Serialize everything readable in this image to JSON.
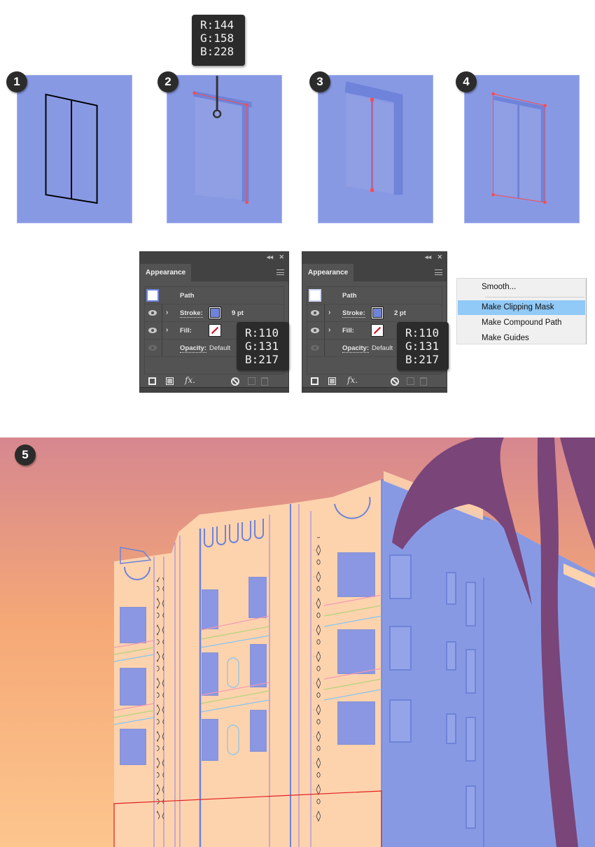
{
  "steps": [
    {
      "number": "1",
      "description": "window outline drawn in black"
    },
    {
      "number": "2",
      "description": "window with stroke highlighted"
    },
    {
      "number": "3",
      "description": "center mullion path selected"
    },
    {
      "number": "4",
      "description": "window frame path selected"
    },
    {
      "number": "5",
      "description": "final art deco building illustration"
    }
  ],
  "colors": {
    "swatch_bg": "#8899e4",
    "window_fill": "#909ee4",
    "window_stroke": "#6e83d9",
    "selection": "#ff4a4a",
    "palm": "#7a4579",
    "building_cream": "#fdd3ae",
    "building_blue": "#8899e4",
    "sky_top": "#d6878f",
    "sky_bottom": "#fbc38a"
  },
  "tooltips": {
    "top": {
      "r": "R:144",
      "g": "G:158",
      "b": "B:228"
    },
    "panel1": {
      "r": "R:110",
      "g": "G:131",
      "b": "B:217"
    },
    "panel2": {
      "r": "R:110",
      "g": "G:131",
      "b": "B:217"
    }
  },
  "panels": [
    {
      "tab": "Appearance",
      "collapse": "◂◂",
      "close": "✕",
      "object": "Path",
      "stroke_label": "Stroke:",
      "stroke_value": "9 pt",
      "fill_label": "Fill:",
      "opacity_label": "Opacity:",
      "opacity_value": "Default"
    },
    {
      "tab": "Appearance",
      "collapse": "◂◂",
      "close": "✕",
      "object": "Path",
      "stroke_label": "Stroke:",
      "stroke_value": "2 pt",
      "fill_label": "Fill:",
      "opacity_label": "Opacity:",
      "opacity_value": "Default"
    }
  ],
  "panel_icons": {
    "chevron": "›",
    "fx": "fx."
  },
  "context_menu": {
    "items": [
      {
        "label": "Smooth...",
        "highlighted": false
      },
      {
        "label": "Make Clipping Mask",
        "highlighted": true
      },
      {
        "label": "Make Compound Path",
        "highlighted": false
      },
      {
        "label": "Make Guides",
        "highlighted": false
      }
    ]
  }
}
